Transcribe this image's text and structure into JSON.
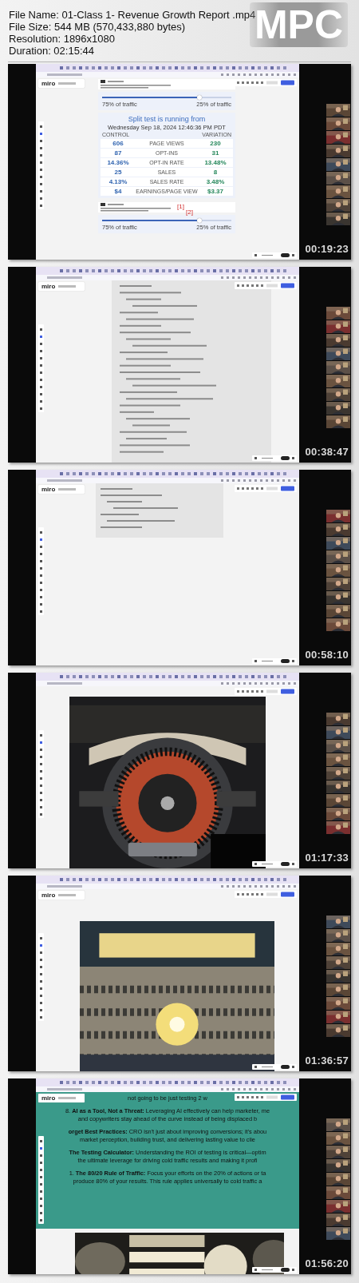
{
  "file_info": {
    "lines": [
      "File Name: 01-Class 1- Revenue Growth Report .mp4",
      "File Size: 544 MB (570,433,880 bytes)",
      "Resolution: 1896x1080",
      "Duration: 02:15:44"
    ],
    "logo": "MPC"
  },
  "frames": [
    {
      "kind": "split_test",
      "timestamp": "00:19:23",
      "app_name": "miro",
      "slider": {
        "left_label": "75% of traffic",
        "right_label": "25% of traffic",
        "level": 0.75
      },
      "test": {
        "title": "Split test is running from",
        "date": "Wednesday Sep 18, 2024 12:46:36 PM PDT",
        "columns": [
          "CONTROL",
          "VARIATION"
        ],
        "rows": [
          {
            "control": "606",
            "metric": "PAGE VIEWS",
            "variation": "230"
          },
          {
            "control": "87",
            "metric": "OPT-INS",
            "variation": "31"
          },
          {
            "control": "14.36%",
            "metric": "OPT-IN RATE",
            "variation": "13.48%"
          },
          {
            "control": "25",
            "metric": "SALES",
            "variation": "8"
          },
          {
            "control": "4.13%",
            "metric": "SALES RATE",
            "variation": "3.48%"
          },
          {
            "control": "$4",
            "metric": "EARNINGS/PAGE VIEW",
            "variation": "$3.37"
          }
        ]
      },
      "markers": [
        "[1]",
        "[2]"
      ],
      "slider_2": {
        "left_label": "75% of traffic",
        "right_label": "25% of traffic",
        "level": 0.75
      }
    },
    {
      "kind": "notes",
      "timestamp": "00:38:47",
      "app_name": "miro"
    },
    {
      "kind": "board",
      "timestamp": "00:58:10",
      "app_name": "miro"
    },
    {
      "kind": "poster",
      "timestamp": "01:17:33"
    },
    {
      "kind": "poster",
      "timestamp": "01:36:57",
      "app_name": "miro"
    },
    {
      "kind": "slide",
      "timestamp": "01:56:20",
      "app_name": "miro",
      "paragraphs": [
        [
          "not going to be just testing 2 w"
        ],
        [
          "8. **AI as a Tool, Not a Threat:** Leveraging AI effectively can help marketer, me",
          "and copywriters stay ahead of the curve instead of being displaced b"
        ],
        [
          "**orget Best Practices:** CRO isn't just about improving conversions; it's abou",
          "market perception, building trust, and delivering lasting value to clie"
        ],
        [
          "**The Testing Calculator:** Understanding the ROI of testing is critical—optim",
          "the ultimate leverage for driving cold traffic results and making it profi"
        ],
        [
          "1. **The 80/20 Rule of Traffic:** Focus your efforts on the 20% of actions or ta",
          "produce 80% of your results. This rule applies universally to cold traffic a"
        ]
      ]
    }
  ]
}
